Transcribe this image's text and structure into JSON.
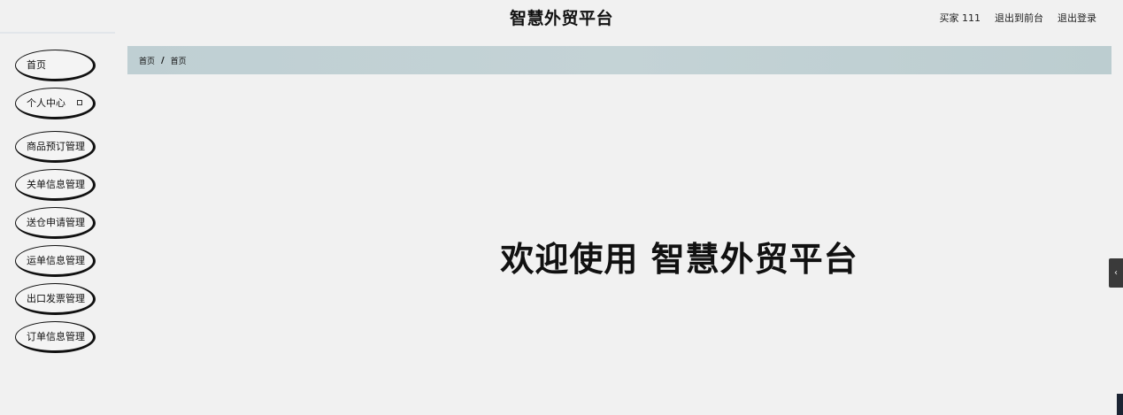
{
  "header": {
    "title": "智慧外贸平台",
    "user": "买家 111",
    "to_front": "退出到前台",
    "logout": "退出登录"
  },
  "sidebar": {
    "items": [
      {
        "label": "首页"
      },
      {
        "label": "个人中心"
      },
      {
        "label": "商品预订管理"
      },
      {
        "label": "关单信息管理"
      },
      {
        "label": "送仓申请管理"
      },
      {
        "label": "运单信息管理"
      },
      {
        "label": "出口发票管理"
      },
      {
        "label": "订单信息管理"
      }
    ]
  },
  "breadcrumb": {
    "home": "首页",
    "separator": "/",
    "current": "首页"
  },
  "main": {
    "welcome": "欢迎使用 智慧外贸平台"
  },
  "side_tab": {
    "icon": "chevron-left-icon",
    "glyph": "‹"
  }
}
